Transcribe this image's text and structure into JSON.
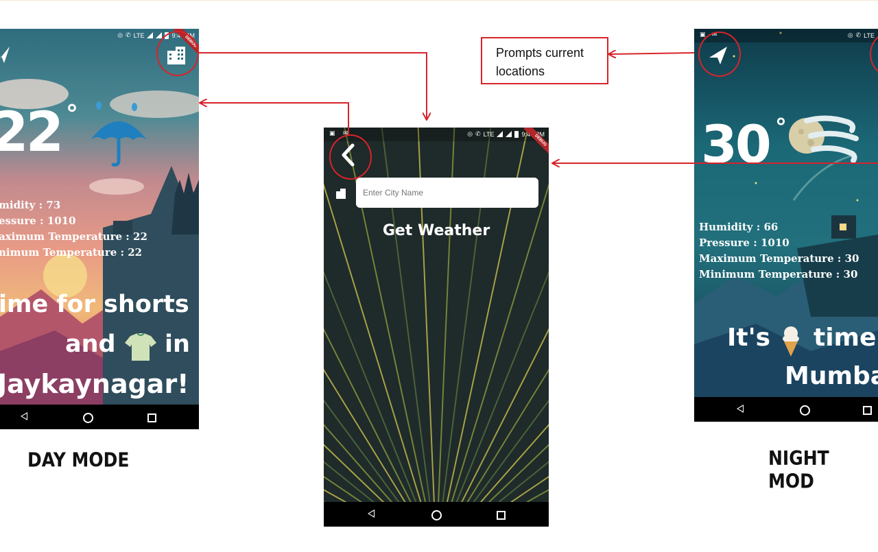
{
  "colors": {
    "annotation": "#d8232a",
    "callout_bg": "#ffffff"
  },
  "day_phone": {
    "status_time": "9:46 PM",
    "status_network": "LTE",
    "debug_ribbon": "DEBUG",
    "temperature": "22",
    "degree": "°",
    "weather_icon": "umbrella-rain-icon",
    "humidity": "midity : 73",
    "pressure": "essure : 1010",
    "max_temp": "aximum Temperature : 22",
    "min_temp": "nimum Temperature : 22",
    "message_line1": "ime for shorts",
    "message_line2_a": "and",
    "message_line2_icon": "tshirt-icon",
    "message_line2_b": "in",
    "message_line3": "Jaykaynagar!",
    "mode_label": "DAY MODE"
  },
  "search_phone": {
    "status_time": "9:46 PM",
    "status_network": "LTE",
    "debug_ribbon": "DEBUG",
    "city_placeholder": "Enter City Name",
    "get_weather_label": "Get Weather"
  },
  "night_phone": {
    "status_network": "LTE",
    "temperature": "30",
    "degree": "°",
    "weather_icon": "moon-wind-icon",
    "humidity": "Humidity : 66",
    "pressure": "Pressure : 1010",
    "max_temp": "Maximum Temperature : 30",
    "min_temp": "Minimum Temperature : 30",
    "message_line1_a": "It's",
    "message_line1_icon": "ice-cream-icon",
    "message_line1_b": "time",
    "message_line2": "Mumba",
    "mode_label": "NIGHT MOD"
  },
  "callout": {
    "text_line1": "Prompts current",
    "text_line2": "locations"
  }
}
